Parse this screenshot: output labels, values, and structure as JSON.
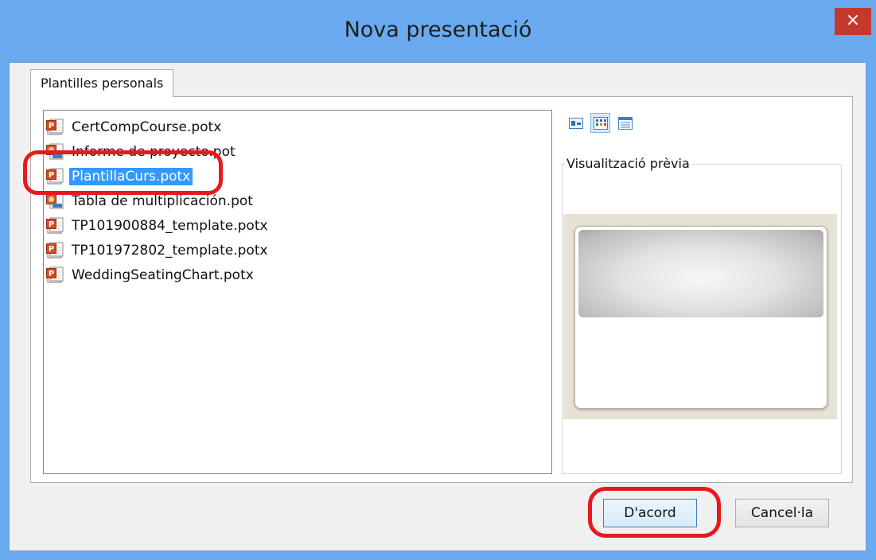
{
  "window": {
    "title": "Nova presentació",
    "close_label": "×"
  },
  "tabs": [
    {
      "label": "Plantilles personals"
    }
  ],
  "files": [
    {
      "name": "CertCompCourse.potx",
      "icon": "potx-icon",
      "selected": false
    },
    {
      "name": "Informe de proyecto.pot",
      "icon": "pot-icon",
      "selected": false
    },
    {
      "name": "PlantillaCurs.potx",
      "icon": "potx-icon",
      "selected": true
    },
    {
      "name": "Tabla de multiplicación.pot",
      "icon": "pot-icon",
      "selected": false
    },
    {
      "name": "TP101900884_template.potx",
      "icon": "potx-icon",
      "selected": false
    },
    {
      "name": "TP101972802_template.potx",
      "icon": "potx-icon",
      "selected": false
    },
    {
      "name": "WeddingSeatingChart.potx",
      "icon": "potx-icon",
      "selected": false
    }
  ],
  "view_modes": [
    {
      "name": "large-icons-view-icon",
      "active": false
    },
    {
      "name": "list-view-icon",
      "active": true
    },
    {
      "name": "details-view-icon",
      "active": false
    }
  ],
  "preview": {
    "label": "Visualització prèvia"
  },
  "buttons": {
    "ok": "D'acord",
    "cancel": "Cancel·la"
  },
  "colors": {
    "selection": "#3399ff",
    "highlight": "#e8191c",
    "titlebar": "#6aaaf0"
  }
}
